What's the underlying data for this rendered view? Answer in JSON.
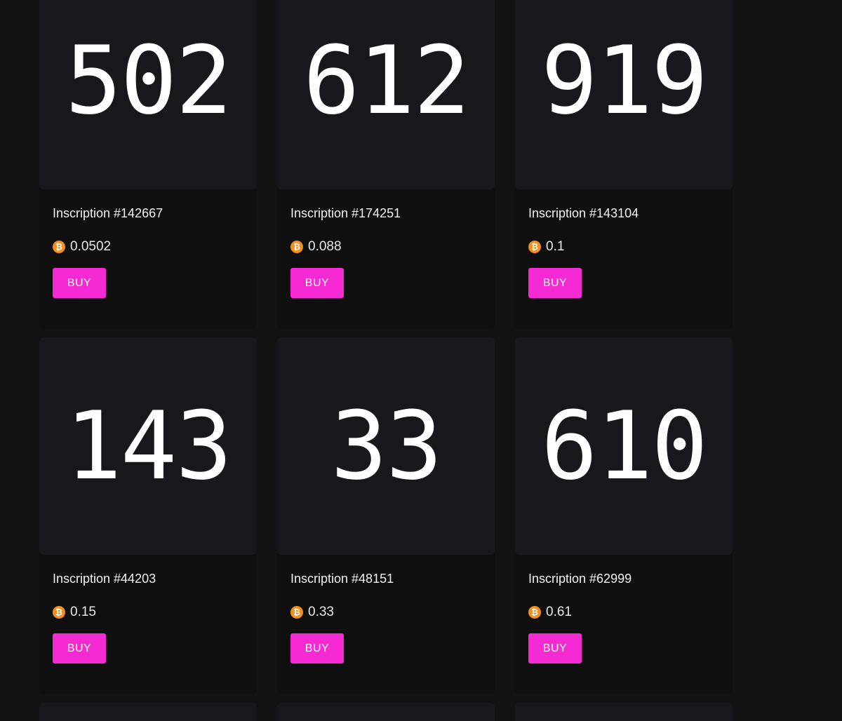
{
  "currency_icon": "bitcoin-icon",
  "accent_color": "#f52ad2",
  "cards": [
    {
      "art": "502",
      "title": "Inscription #142667",
      "price": "0.0502",
      "button": "BUY"
    },
    {
      "art": "612",
      "title": "Inscription #174251",
      "price": "0.088",
      "button": "BUY"
    },
    {
      "art": "919",
      "title": "Inscription #143104",
      "price": "0.1",
      "button": "BUY"
    },
    {
      "art": "143",
      "title": "Inscription #44203",
      "price": "0.15",
      "button": "BUY"
    },
    {
      "art": "33",
      "title": "Inscription #48151",
      "price": "0.33",
      "button": "BUY"
    },
    {
      "art": "610",
      "title": "Inscription #62999",
      "price": "0.61",
      "button": "BUY"
    }
  ]
}
